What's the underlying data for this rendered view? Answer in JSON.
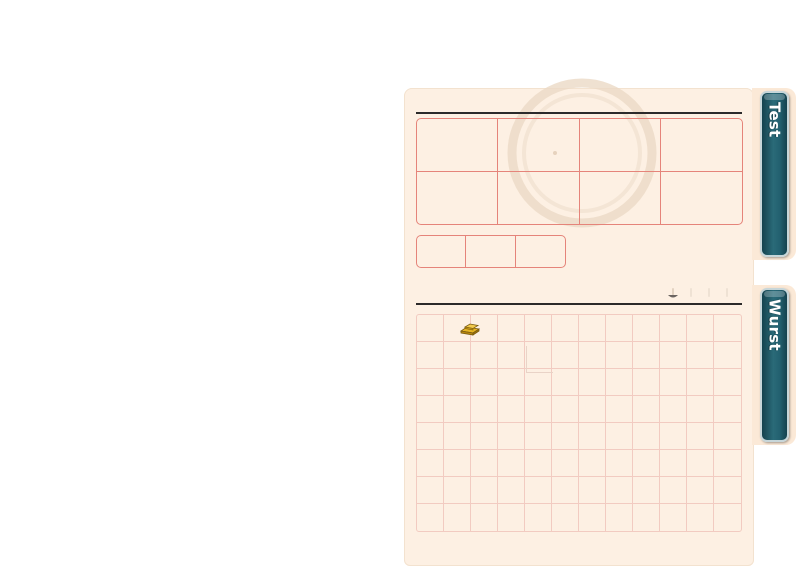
{
  "tabs": [
    {
      "label": "Test"
    },
    {
      "label": "Wurst"
    }
  ],
  "equipment": {
    "top_slots": 8,
    "bottom_slots": 3
  },
  "inventory": {
    "columns": 12,
    "rows": 8,
    "first_slot_count": "",
    "item_icon": "gold-bars-icon"
  },
  "page_indicator": {
    "pages": 4,
    "active_page": 1
  },
  "colors": {
    "panel_bg": "#fdf0e3",
    "slot_border": "#e5847a",
    "grid_line": "#f2cbc1",
    "tab_fill": "#236170"
  }
}
